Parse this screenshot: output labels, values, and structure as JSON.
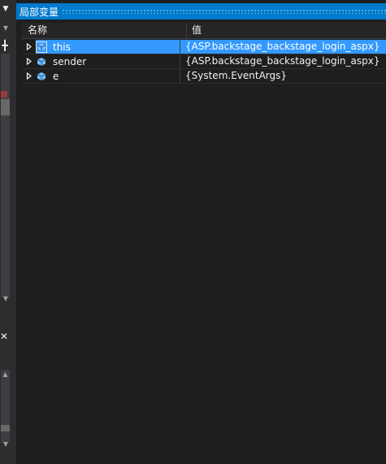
{
  "window": {
    "title": "局部变量"
  },
  "columns": {
    "name": "名称",
    "value": "值"
  },
  "rows": [
    {
      "name": "this",
      "value": "{ASP.backstage_backstage_login_aspx}",
      "selected": true,
      "icon": "object-icon"
    },
    {
      "name": "sender",
      "value": "{ASP.backstage_backstage_login_aspx}",
      "selected": false,
      "icon": "object-icon"
    },
    {
      "name": "e",
      "value": "{System.EventArgs}",
      "selected": false,
      "icon": "object-icon"
    }
  ],
  "colors": {
    "titlebar": "#007acc",
    "selection": "#3399ff",
    "background": "#1e1e1e",
    "chrome": "#2d2d30"
  },
  "left_strip": {
    "icons": [
      "chevron-down-icon",
      "dropdown-arrow-icon",
      "pin-icon",
      "scroll-down-icon",
      "close-icon",
      "scroll-up-icon",
      "scroll-down-icon"
    ]
  }
}
